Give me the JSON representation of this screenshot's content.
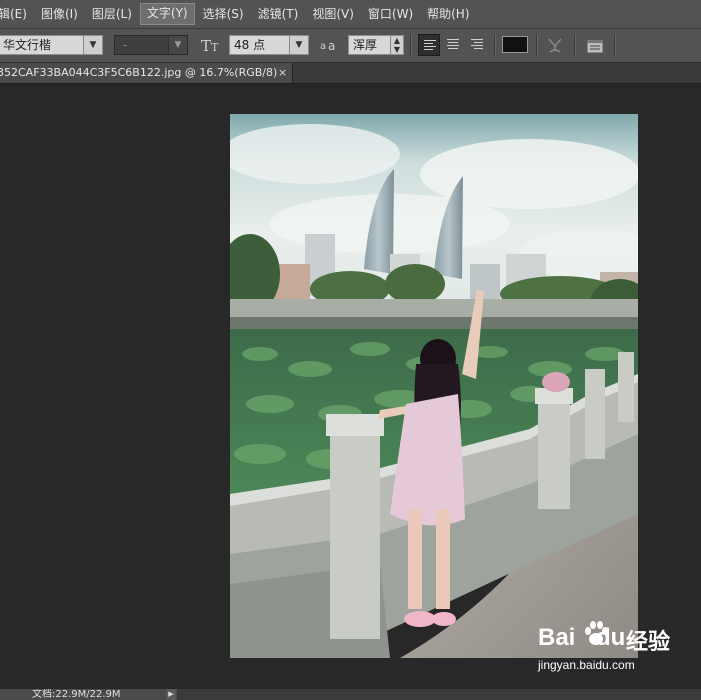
{
  "menu": {
    "items": [
      {
        "label": "辑(E)",
        "active": false
      },
      {
        "label": "图像(I)",
        "active": false
      },
      {
        "label": "图层(L)",
        "active": false
      },
      {
        "label": "文字(Y)",
        "active": true
      },
      {
        "label": "选择(S)",
        "active": false
      },
      {
        "label": "滤镜(T)",
        "active": false
      },
      {
        "label": "视图(V)",
        "active": false
      },
      {
        "label": "窗口(W)",
        "active": false
      },
      {
        "label": "帮助(H)",
        "active": false
      }
    ]
  },
  "options": {
    "font_family": "华文行楷",
    "font_style": "-",
    "font_size": "48 点",
    "antialias": "浑厚",
    "text_color": "#111111"
  },
  "document": {
    "tab_title": "352CAF33BA044C3F5C6B122.jpg @ 16.7%(RGB/8)",
    "close_glyph": "×"
  },
  "status": {
    "doc_info": "文档:22.9M/22.9M",
    "menu_arrow": "▶"
  },
  "watermark": {
    "brand_left": "Bai",
    "brand_right": "du",
    "brand_cn": "经验",
    "url": "jingyan.baidu.com"
  }
}
